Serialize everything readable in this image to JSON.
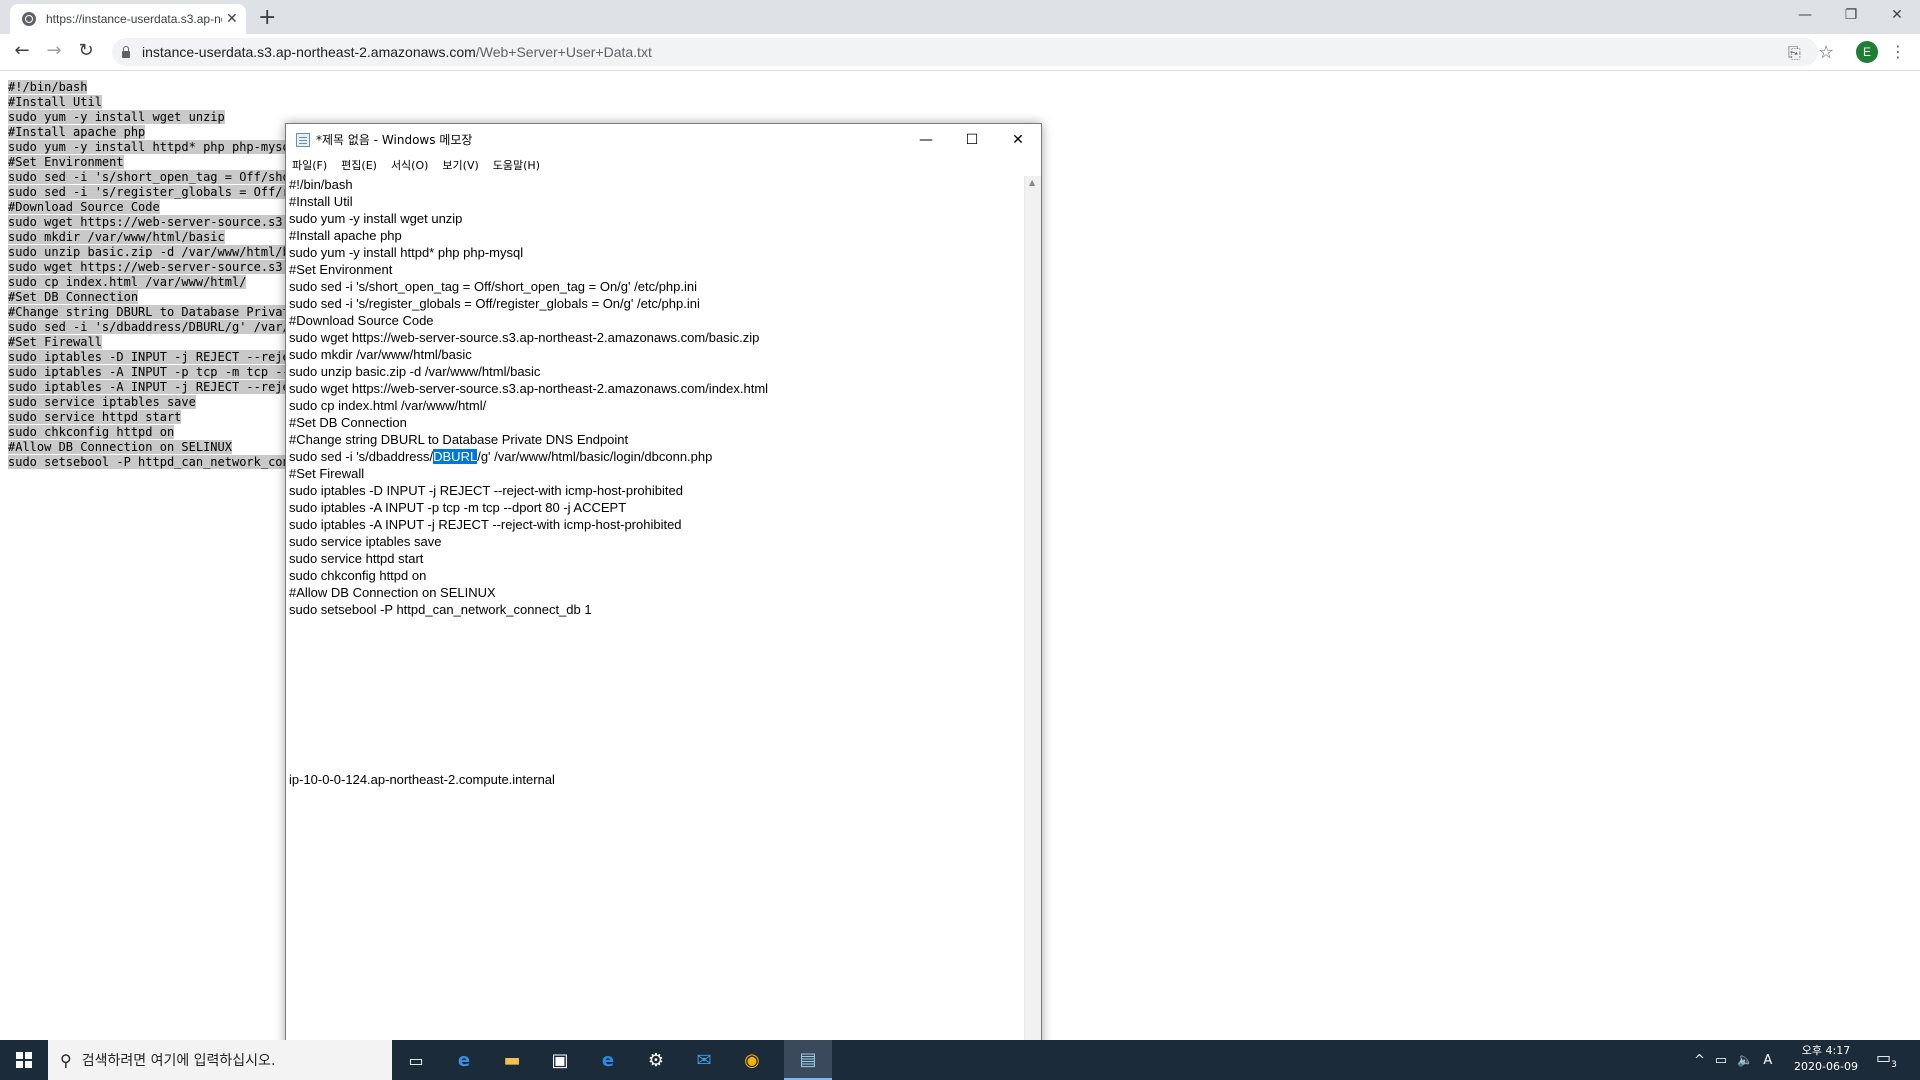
{
  "browser": {
    "tab_title": "https://instance-userdata.s3.ap-no",
    "tab_close": "✕",
    "new_tab": "+",
    "url_host": "instance-userdata.s3.ap-northeast-2.amazonaws.com",
    "url_path": "/Web+Server+User+Data.txt",
    "avatar_letter": "E",
    "window_controls": {
      "minimize": "—",
      "restore": "❐",
      "close": "✕"
    }
  },
  "page_lines": [
    "#!/bin/bash",
    "#Install Util",
    "sudo yum -y install wget unzip",
    "#Install apache php",
    "sudo yum -y install httpd* php php-mysql",
    "#Set Environment",
    "sudo sed -i 's/short_open_tag = Off/shor",
    "sudo sed -i 's/register_globals = Off/re",
    "#Download Source Code",
    "sudo wget https://web-server-source.s3.a",
    "sudo mkdir /var/www/html/basic",
    "sudo unzip basic.zip -d /var/www/html/ba",
    "sudo wget https://web-server-source.s3.a",
    "sudo cp index.html /var/www/html/",
    "#Set DB Connection",
    "#Change string DBURL to Database Private",
    "sudo sed -i 's/dbaddress/DBURL/g' /var/w",
    "#Set Firewall",
    "sudo iptables -D INPUT -j REJECT --rejec",
    "sudo iptables -A INPUT -p tcp -m tcp --d",
    "sudo iptables -A INPUT -j REJECT --rejec",
    "sudo service iptables save",
    "sudo service httpd start",
    "sudo chkconfig httpd on",
    "#Allow DB Connection on SELINUX",
    "sudo setsebool -P httpd_can_network_conn"
  ],
  "notepad": {
    "title": "*제목 없음 - Windows 메모장",
    "menu": [
      "파일(F)",
      "편집(E)",
      "서식(O)",
      "보기(V)",
      "도움말(H)"
    ],
    "controls": {
      "minimize": "—",
      "maximize": "☐",
      "close": "✕"
    },
    "lines_before": [
      "#!/bin/bash",
      "#Install Util",
      "sudo yum -y install wget unzip",
      "#Install apache php",
      "sudo yum -y install httpd* php php-mysql",
      "#Set Environment",
      "sudo sed -i 's/short_open_tag = Off/short_open_tag = On/g' /etc/php.ini",
      "sudo sed -i 's/register_globals = Off/register_globals = On/g' /etc/php.ini",
      "#Download Source Code",
      "sudo wget https://web-server-source.s3.ap-northeast-2.amazonaws.com/basic.zip",
      "sudo mkdir /var/www/html/basic",
      "sudo unzip basic.zip -d /var/www/html/basic",
      "sudo wget https://web-server-source.s3.ap-northeast-2.amazonaws.com/index.html",
      "sudo cp index.html /var/www/html/",
      "#Set DB Connection",
      "#Change string DBURL to Database Private DNS Endpoint"
    ],
    "sed_line": {
      "prefix": "sudo sed -i 's/dbaddress/",
      "selected": "DBURL",
      "suffix": "/g' /var/www/html/basic/login/dbconn.php"
    },
    "lines_after": [
      "#Set Firewall",
      "sudo iptables -D INPUT -j REJECT --reject-with icmp-host-prohibited",
      "sudo iptables -A INPUT -p tcp -m tcp --dport 80 -j ACCEPT",
      "sudo iptables -A INPUT -j REJECT --reject-with icmp-host-prohibited",
      "sudo service iptables save",
      "sudo service httpd start",
      "sudo chkconfig httpd on",
      "#Allow DB Connection on SELINUX",
      "sudo setsebool -P httpd_can_network_connect_db 1"
    ],
    "hostname_line": "ip-10-0-0-124.ap-northeast-2.compute.internal"
  },
  "taskbar": {
    "search_placeholder": "검색하려면 여기에 입력하십시오.",
    "clock_time": "오후 4:17",
    "clock_date": "2020-06-09",
    "ime": "A",
    "notification_count": "3"
  }
}
